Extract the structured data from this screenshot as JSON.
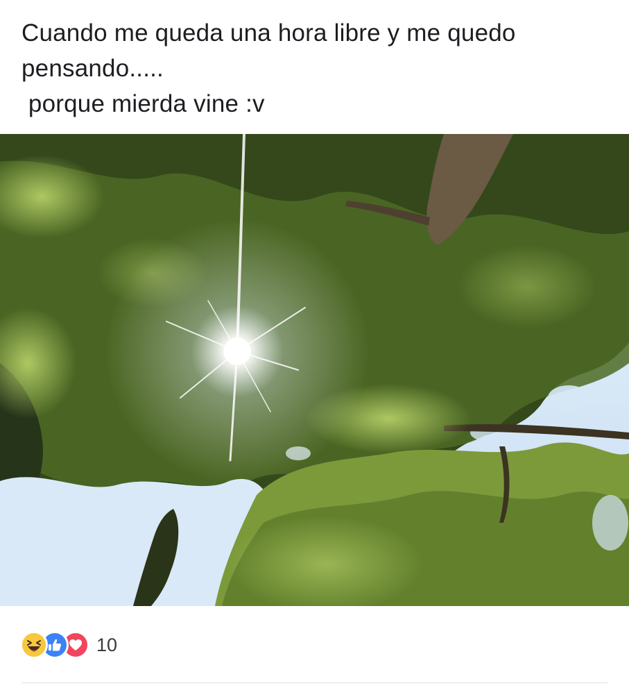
{
  "post": {
    "text_lines": [
      "Cuando me queda una hora libre y me quedo",
      "pensando.....",
      " porque mierda vine :v"
    ]
  },
  "photo": {
    "subject": "looking up through tree canopy at the sun",
    "colors": {
      "sky": "#d3e6f5",
      "foliage_dark": "#2d3f17",
      "foliage_mid": "#5b7a2a",
      "foliage_light": "#a6c25a",
      "trunk": "#6b5a44",
      "sun": "#ffffff"
    }
  },
  "reactions": {
    "icons": [
      "haha-icon",
      "like-icon",
      "love-icon"
    ],
    "count": "10"
  }
}
